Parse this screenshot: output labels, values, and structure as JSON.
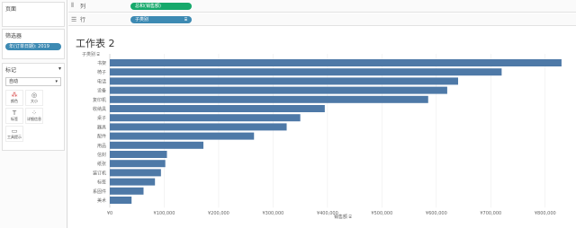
{
  "sidebar": {
    "pages_label": "页面",
    "filters_label": "筛选器",
    "filter_pill": "年(订单日期): 2019",
    "marks_label": "标记",
    "marks_dropdown": "自动",
    "mark_buttons": [
      "颜色",
      "大小",
      "标签",
      "详细信息",
      "工具提示"
    ]
  },
  "shelves": {
    "columns_label": "列",
    "columns_pill": "总和(销售额)",
    "rows_label": "行",
    "rows_pill": "子类别"
  },
  "sheet": {
    "title": "工作表 2",
    "dimension_header": "子类别",
    "axis_title": "销售额"
  },
  "chart_data": {
    "type": "bar",
    "orientation": "horizontal",
    "categories": [
      "书架",
      "椅子",
      "电话",
      "设备",
      "复印机",
      "收纳具",
      "桌子",
      "器具",
      "配件",
      "用品",
      "信封",
      "纸张",
      "装订机",
      "标签",
      "系固件",
      "美术"
    ],
    "values": [
      830000,
      720000,
      640000,
      620000,
      585000,
      395000,
      350000,
      325000,
      265000,
      172000,
      105000,
      102000,
      94000,
      83000,
      62000,
      40000
    ],
    "xlim": [
      0,
      850000
    ],
    "xticks": [
      0,
      100000,
      200000,
      300000,
      400000,
      500000,
      600000,
      700000,
      800000
    ],
    "xtick_labels": [
      "¥0",
      "¥100,000",
      "¥200,000",
      "¥300,000",
      "¥400,000",
      "¥500,000",
      "¥600,000",
      "¥700,000",
      "¥800,000"
    ],
    "bar_color": "#4e79a7",
    "grid": true
  }
}
